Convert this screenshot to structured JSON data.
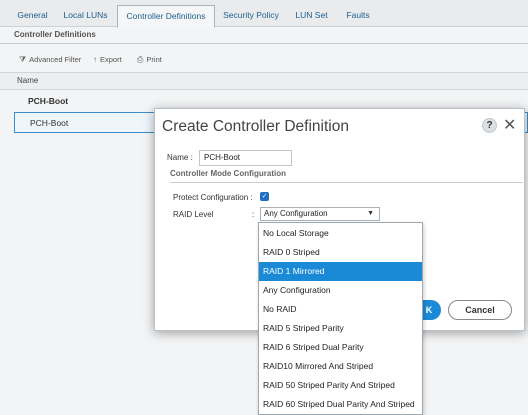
{
  "tabs": [
    "General",
    "Local LUNs",
    "Controller Definitions",
    "Security Policy",
    "LUN Set",
    "Faults"
  ],
  "active_tab": "Controller Definitions",
  "section_title": "Controller Definitions",
  "toolbar": {
    "filter": "Advanced Filter",
    "export": "Export",
    "print": "Print"
  },
  "grid": {
    "column": "Name",
    "group": "PCH-Boot",
    "selected_row": "PCH-Boot"
  },
  "dialog": {
    "title": "Create Controller Definition",
    "help": "?",
    "close": "✕",
    "name_label": "Name :",
    "name_value": "PCH-Boot",
    "section": "Controller Mode Configuration",
    "protect_label": "Protect Configuration :",
    "protect_checked": true,
    "raid_label": "RAID Level",
    "raid_colon": ":",
    "raid_value": "Any Configuration",
    "ok_label": "K",
    "cancel_label": "Cancel"
  },
  "raid_options": [
    "No Local Storage",
    "RAID 0 Striped",
    "RAID 1 Mirrored",
    "Any Configuration",
    "No RAID",
    "RAID 5 Striped Parity",
    "RAID 6 Striped Dual Parity",
    "RAID10 Mirrored And Striped",
    "RAID 50 Striped Parity And Striped",
    "RAID 60 Striped Dual Parity And Striped"
  ],
  "highlighted_option": "RAID 1 Mirrored",
  "colors": {
    "accent": "#1b8ad6",
    "tab_text": "#1b5f8f"
  },
  "icons": {
    "filter": "filter-icon",
    "export": "export-icon",
    "print": "print-icon",
    "help": "help-icon",
    "close": "close-icon",
    "checkbox": "check-icon"
  }
}
